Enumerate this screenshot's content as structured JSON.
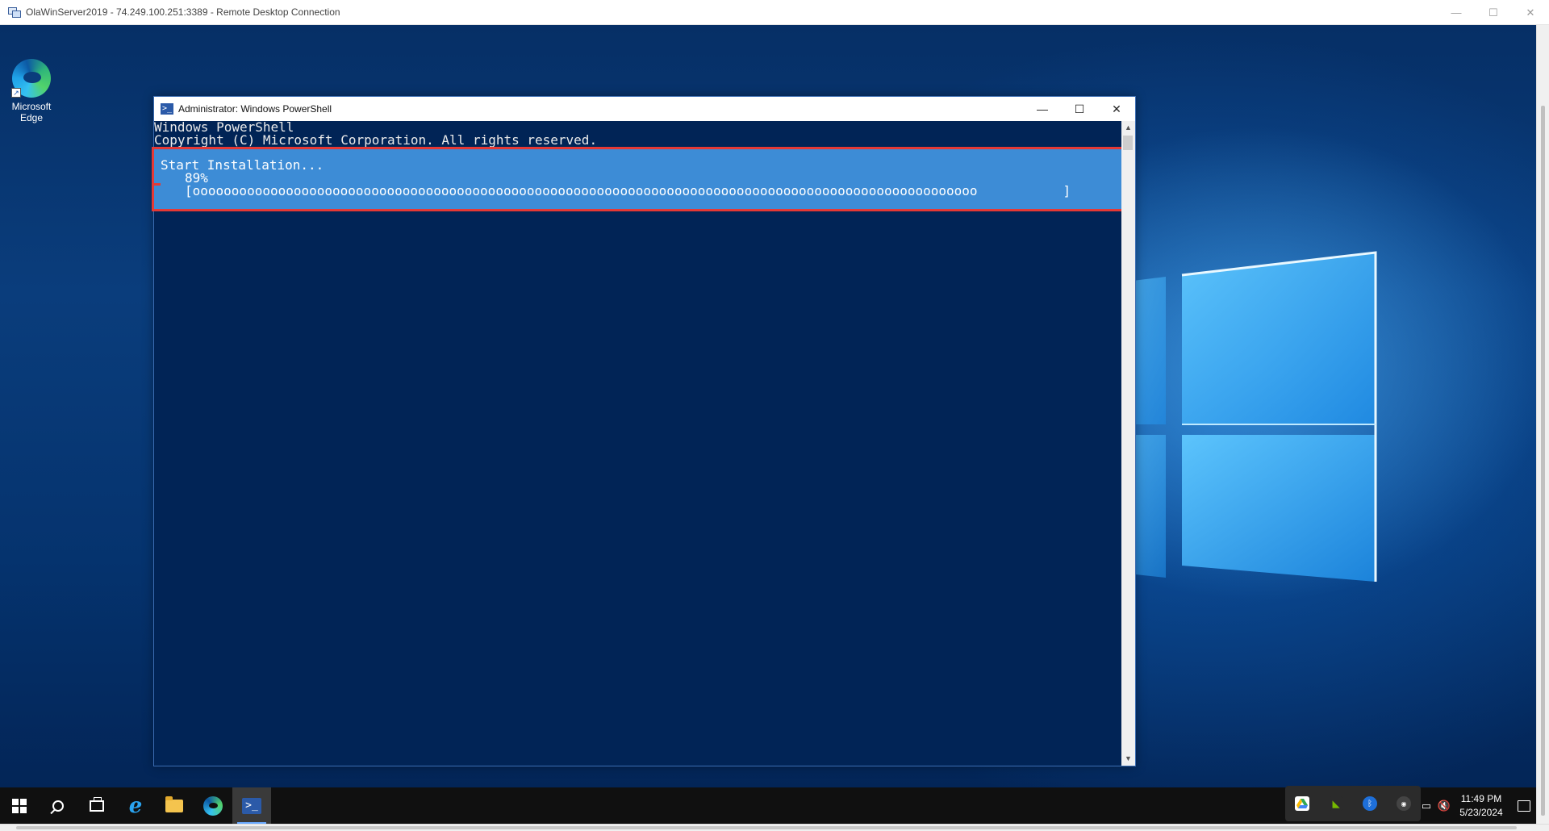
{
  "rdp": {
    "title": "OlaWinServer2019 - 74.249.100.251:3389 - Remote Desktop Connection",
    "minimize": "—",
    "maximize": "☐",
    "close": "✕"
  },
  "desktop": {
    "icons": [
      {
        "label_line1": "Microsoft",
        "label_line2": "Edge"
      }
    ]
  },
  "powershell": {
    "title": "Administrator: Windows PowerShell",
    "icon_glyph": ">_",
    "minimize": "—",
    "maximize": "☐",
    "close": "✕",
    "lines": [
      "Windows PowerShell",
      "Copyright (C) Microsoft Corporation. All rights reserved."
    ],
    "progress": {
      "activity": "Start Installation...",
      "percent_text": "89%",
      "bar_text": "[ooooooooooooooooooooooooooooooooooooooooooooooooooooooooooooooooooooooooooooooooooooooooooooooooooooo           ]",
      "percent_value": 89
    },
    "scroll_up": "▲",
    "scroll_down": "▼"
  },
  "taskbar": {
    "items": [
      {
        "name": "start",
        "active": false
      },
      {
        "name": "search",
        "active": false
      },
      {
        "name": "task-view",
        "active": false
      },
      {
        "name": "internet-explorer",
        "glyph": "e",
        "active": false
      },
      {
        "name": "file-explorer",
        "active": false
      },
      {
        "name": "microsoft-edge",
        "active": false
      },
      {
        "name": "powershell",
        "glyph": ">_",
        "active": true
      }
    ],
    "tray_popup_icons": [
      "google-drive-icon",
      "nvidia-icon",
      "bluetooth-icon",
      "app-icon"
    ],
    "tray_icons": [
      "network-icon",
      "volume-muted-icon"
    ],
    "clock": {
      "time": "11:49 PM",
      "date": "5/23/2024"
    }
  },
  "colors": {
    "powershell_bg": "#012456",
    "progress_bg": "#3d8cd6",
    "highlight_border": "#e53935",
    "taskbar_bg": "#101010"
  }
}
